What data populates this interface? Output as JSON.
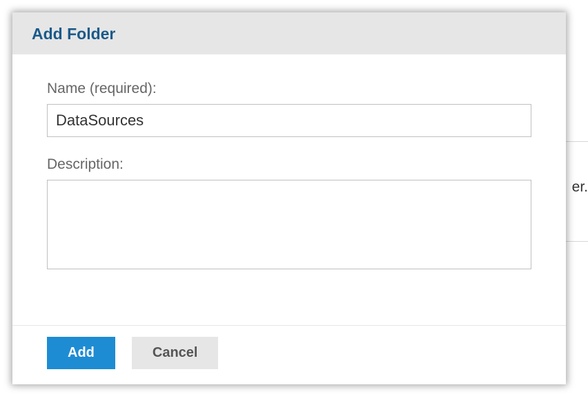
{
  "background": {
    "partial_text": "er."
  },
  "dialog": {
    "title": "Add Folder",
    "fields": {
      "name": {
        "label": "Name (required):",
        "value": "DataSources"
      },
      "description": {
        "label": "Description:",
        "value": ""
      }
    },
    "buttons": {
      "add": "Add",
      "cancel": "Cancel"
    }
  }
}
